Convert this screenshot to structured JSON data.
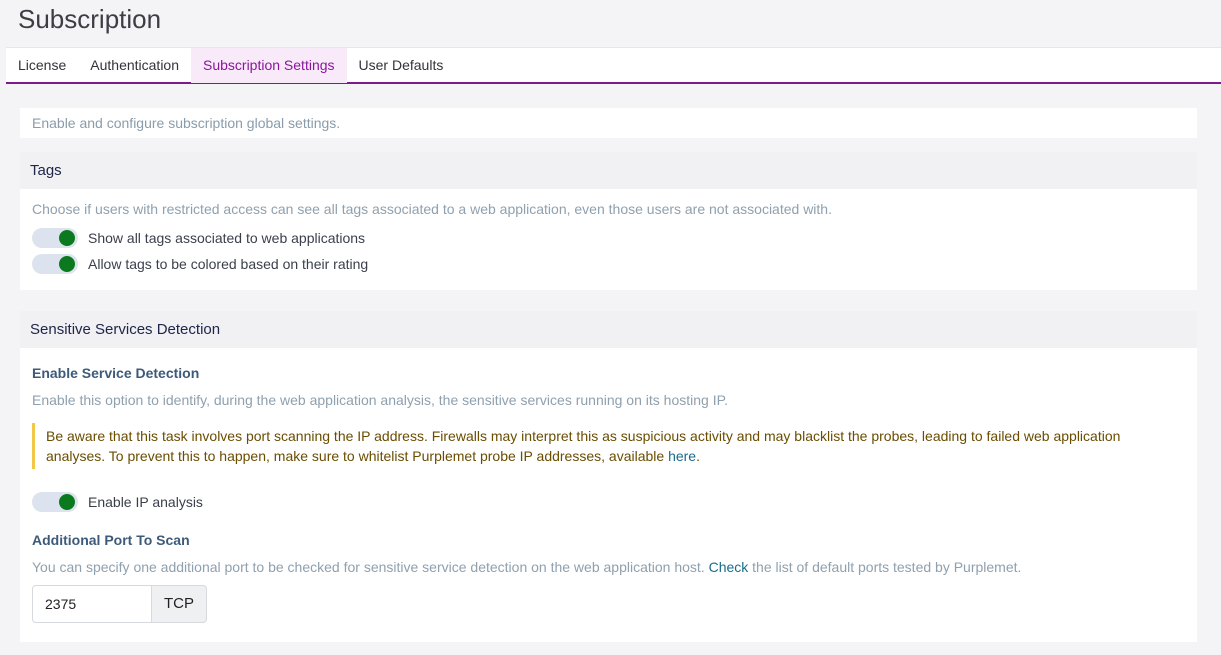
{
  "page": {
    "title": "Subscription"
  },
  "tabs": [
    {
      "label": "License",
      "active": false
    },
    {
      "label": "Authentication",
      "active": false
    },
    {
      "label": "Subscription Settings",
      "active": true
    },
    {
      "label": "User Defaults",
      "active": false
    }
  ],
  "intro": "Enable and configure subscription global settings.",
  "tags": {
    "heading": "Tags",
    "description": "Choose if users with restricted access can see all tags associated to a web application, even those users are not associated with.",
    "toggles": [
      {
        "label": "Show all tags associated to web applications",
        "on": true
      },
      {
        "label": "Allow tags to be colored based on their rating",
        "on": true
      }
    ]
  },
  "sensitive": {
    "heading": "Sensitive Services Detection",
    "enable_title": "Enable Service Detection",
    "enable_description": "Enable this option to identify, during the web application analysis, the sensitive services running on its hosting IP.",
    "warning_text": "Be aware that this task involves port scanning the IP address. Firewalls may interpret this as suspicious activity and may blacklist the probes, leading to failed web application analyses. To prevent this to happen, make sure to whitelist Purplemet probe IP addresses, available ",
    "warning_link": "here",
    "warning_end": ".",
    "ip_toggle": {
      "label": "Enable IP analysis",
      "on": true
    },
    "port_title": "Additional Port To Scan",
    "port_desc_start": "You can specify one additional port to be checked for sensitive service detection on the web application host. ",
    "port_desc_link": "Check",
    "port_desc_end": " the list of default ports tested by Purplemet.",
    "port_value": "2375",
    "port_protocol": "TCP"
  },
  "colors": {
    "accent": "#7a1a8c",
    "toggle_on": "#0b7a1e",
    "warning_border": "#f2c84b"
  }
}
